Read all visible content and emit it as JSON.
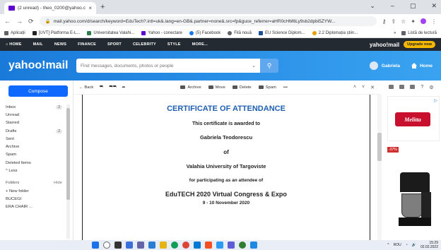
{
  "browser": {
    "tab_title": "(2 unread) - theo_0200@yahoo.c",
    "tab_close": "×",
    "new_tab": "+",
    "window_controls": [
      "⌄",
      "–",
      "▢",
      "✕"
    ],
    "back": "←",
    "forward": "→",
    "reload": "⟳",
    "url": "mail.yahoo.com/d/search/keyword=EduTech?.intl=uk&.lang=en-GB&.partner=none&.src=fp&guce_referrer=aHR0cHM6Ly9sb2dpbi5ZYW...",
    "bookmarks": [
      "Aplicații",
      "[UVT] Platforma E-L...",
      "Universitatea Valahi...",
      "Yahoo - conectare",
      "(5) Facebook",
      "Filă nouă",
      "EU Science Diplom...",
      "2.2 Diplomația știin..."
    ],
    "bookmarks_more": "»",
    "reading_list": "Listă de lectură"
  },
  "yahoo_nav": {
    "items": [
      "HOME",
      "MAIL",
      "NEWS",
      "FINANCE",
      "SPORT",
      "CELEBRITY",
      "STYLE",
      "MORE..."
    ],
    "mail_logo": "yahoo!mail",
    "upgrade": "Upgrade now"
  },
  "header": {
    "logo": "yahoo!mail",
    "search_placeholder": "Find messages, documents, photos or people",
    "user_name": "Gabriela",
    "home_label": "Home"
  },
  "sidebar": {
    "compose": "Compose",
    "folders": [
      {
        "label": "Inbox",
        "count": "2"
      },
      {
        "label": "Unread",
        "count": ""
      },
      {
        "label": "Starred",
        "count": ""
      },
      {
        "label": "Drafts",
        "count": "2"
      },
      {
        "label": "Sent",
        "count": ""
      },
      {
        "label": "Archive",
        "count": ""
      },
      {
        "label": "Spam",
        "count": ""
      },
      {
        "label": "Deleted Items",
        "count": ""
      },
      {
        "label": "^ Less",
        "count": ""
      }
    ],
    "folders_header": "Folders",
    "hide": "Hide",
    "new_folder": "+ New folder",
    "custom_folders": [
      "BUCEGI",
      "ERA CHAIR ..."
    ]
  },
  "toolbar": {
    "back": "← Back",
    "archive": "Archive",
    "move": "Move",
    "delete": "Delete",
    "spam": "Spam",
    "more": "•••"
  },
  "certificate": {
    "title": "CERTIFICATE OF ATTENDANCE",
    "line1": "This certificate is awarded to",
    "name": "Gabriela Teodorescu",
    "of": "of",
    "institution": "Valahia University of Targoviste",
    "participation": "for participating as an attendee of",
    "event": "EduTECH 2020 Virtual Congress & Expo",
    "dates": "9 - 10 November 2020"
  },
  "ads": {
    "ad_choice": "▷",
    "brand": "Melitta",
    "discount": "-37%"
  },
  "taskbar": {
    "lang": "ROU",
    "time": "15:29",
    "date": "02.02.2022"
  }
}
